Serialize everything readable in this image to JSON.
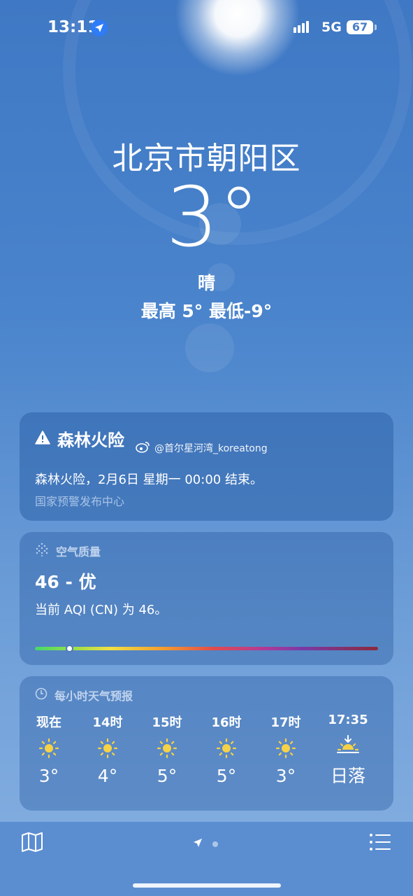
{
  "status_bar": {
    "time": "13:11",
    "network": "5G",
    "battery": "67"
  },
  "location": "北京市朝阳区",
  "current": {
    "temperature": "3°",
    "condition": "晴",
    "high_low": "最高 5°  最低-9°"
  },
  "alert": {
    "title": "森林火险",
    "watermark": "@首尔星河湾_koreatong",
    "body": "森林火险，2月6日 星期一 00:00 结束。",
    "source": "国家预警发布中心"
  },
  "air_quality": {
    "label": "空气质量",
    "value": "46 - 优",
    "description": "当前 AQI (CN) 为 46。",
    "aqi_level": 0.1
  },
  "hourly": {
    "label": "每小时天气预报",
    "items": [
      {
        "time": "现在",
        "icon": "sun-icon",
        "temp": "3°"
      },
      {
        "time": "14时",
        "icon": "sun-icon",
        "temp": "4°"
      },
      {
        "time": "15时",
        "icon": "sun-icon",
        "temp": "5°"
      },
      {
        "time": "16时",
        "icon": "sun-icon",
        "temp": "5°"
      },
      {
        "time": "17时",
        "icon": "sun-icon",
        "temp": "3°"
      },
      {
        "time": "17:35",
        "icon": "sunset-icon",
        "temp": "日落"
      }
    ]
  },
  "toolbar": {
    "icons": [
      "map-icon",
      "location-arrow-icon",
      "list-icon"
    ]
  }
}
